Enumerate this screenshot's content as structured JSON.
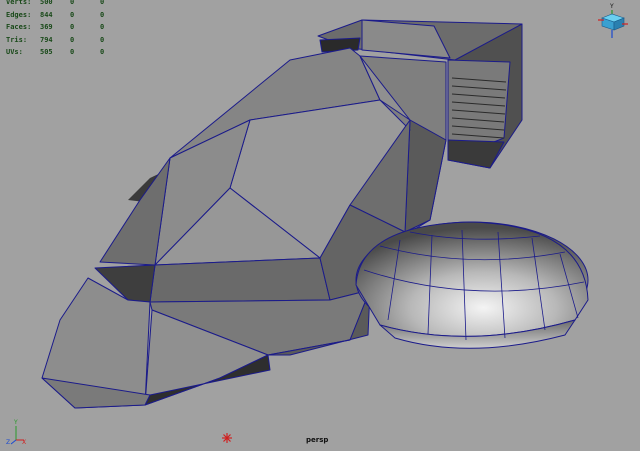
{
  "hud": {
    "rows": [
      {
        "label": "Verts:",
        "v1": "500",
        "v2": "0",
        "v3": "0"
      },
      {
        "label": "Edges:",
        "v1": "844",
        "v2": "0",
        "v3": "0"
      },
      {
        "label": "Faces:",
        "v1": "369",
        "v2": "0",
        "v3": "0"
      },
      {
        "label": "Tris:",
        "v1": "794",
        "v2": "0",
        "v3": "0"
      },
      {
        "label": "UVs:",
        "v1": "505",
        "v2": "0",
        "v3": "0"
      }
    ]
  },
  "viewport": {
    "camera_label": "persp",
    "background_color": "#a1a1a1",
    "wireframe_color": "#1b1b8a"
  },
  "axes": {
    "corner": {
      "y": "Y",
      "z": "Z",
      "x": "X"
    },
    "cube": {
      "y": "Y"
    }
  }
}
